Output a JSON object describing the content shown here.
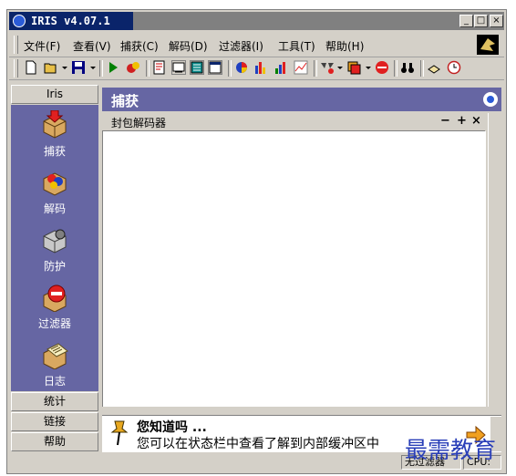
{
  "window": {
    "title": "IRIS v4.07.1",
    "controls": {
      "minimize": "_",
      "maximize": "□",
      "close": "×"
    }
  },
  "menu": {
    "items": [
      "文件(F)",
      "查看(V)",
      "捕获(C)",
      "解码(D)",
      "过滤器(I)",
      "工具(T)",
      "帮助(H)"
    ]
  },
  "toolbar": {
    "icons": [
      "new-icon",
      "open-icon",
      "save-icon",
      "play-icon",
      "stop-icon",
      "decode-icon",
      "view-icon",
      "grid-icon",
      "grid2-icon",
      "pie-chart-icon",
      "bar-chart-icon",
      "bar-chart2-icon",
      "line-chart-icon",
      "filter-icon",
      "layers-icon",
      "stop-sign-icon",
      "binoculars-icon",
      "log-icon",
      "clock-icon"
    ]
  },
  "left_panel": {
    "header": "Iris",
    "items": [
      {
        "label": "捕获",
        "icon": "capture-icon"
      },
      {
        "label": "解码",
        "icon": "decode-icon"
      },
      {
        "label": "防护",
        "icon": "protect-icon"
      },
      {
        "label": "过滤器",
        "icon": "filter-icon"
      },
      {
        "label": "日志",
        "icon": "log-icon"
      }
    ],
    "bottom_buttons": [
      "统计",
      "链接",
      "帮助"
    ]
  },
  "main": {
    "title": "捕获",
    "decoder_title": "封包解码器",
    "decoder_controls": [
      "−",
      "+",
      "×"
    ]
  },
  "tip": {
    "title": "您知道吗 ...",
    "text": "您可以在状态栏中查看了解到内部缓冲区中"
  },
  "status": {
    "filter": "无过滤器",
    "cpu": "CPU:"
  },
  "watermark": "最需教育",
  "colors": {
    "accent": "#6666a3",
    "titlebar": "#0a246a",
    "chrome": "#d4d0c8"
  }
}
